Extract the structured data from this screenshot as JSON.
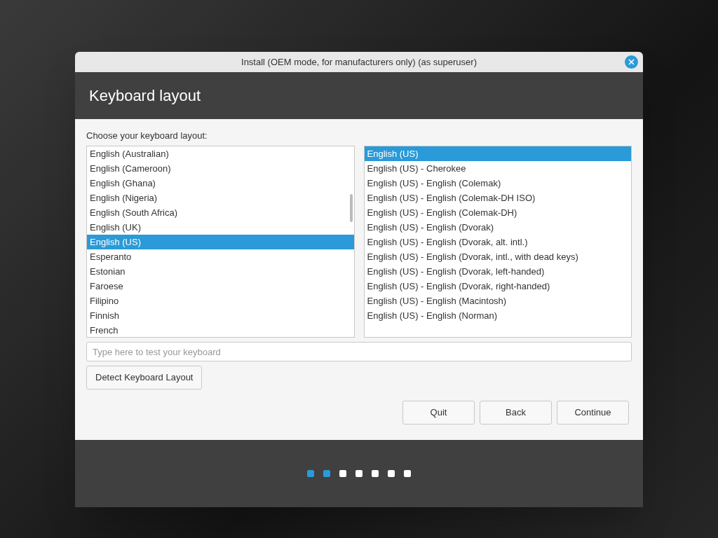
{
  "window": {
    "title": "Install (OEM mode, for manufacturers only) (as superuser)"
  },
  "header": {
    "title": "Keyboard layout"
  },
  "prompt": "Choose your keyboard layout:",
  "layouts": [
    {
      "label": "English (Australian)",
      "selected": false
    },
    {
      "label": "English (Cameroon)",
      "selected": false
    },
    {
      "label": "English (Ghana)",
      "selected": false
    },
    {
      "label": "English (Nigeria)",
      "selected": false
    },
    {
      "label": "English (South Africa)",
      "selected": false
    },
    {
      "label": "English (UK)",
      "selected": false
    },
    {
      "label": "English (US)",
      "selected": true
    },
    {
      "label": "Esperanto",
      "selected": false
    },
    {
      "label": "Estonian",
      "selected": false
    },
    {
      "label": "Faroese",
      "selected": false
    },
    {
      "label": "Filipino",
      "selected": false
    },
    {
      "label": "Finnish",
      "selected": false
    },
    {
      "label": "French",
      "selected": false
    }
  ],
  "variants": [
    {
      "label": "English (US)",
      "selected": true
    },
    {
      "label": "English (US) - Cherokee",
      "selected": false
    },
    {
      "label": "English (US) - English (Colemak)",
      "selected": false
    },
    {
      "label": "English (US) - English (Colemak-DH ISO)",
      "selected": false
    },
    {
      "label": "English (US) - English (Colemak-DH)",
      "selected": false
    },
    {
      "label": "English (US) - English (Dvorak)",
      "selected": false
    },
    {
      "label": "English (US) - English (Dvorak, alt. intl.)",
      "selected": false
    },
    {
      "label": "English (US) - English (Dvorak, intl., with dead keys)",
      "selected": false
    },
    {
      "label": "English (US) - English (Dvorak, left-handed)",
      "selected": false
    },
    {
      "label": "English (US) - English (Dvorak, right-handed)",
      "selected": false
    },
    {
      "label": "English (US) - English (Macintosh)",
      "selected": false
    },
    {
      "label": "English (US) - English (Norman)",
      "selected": false
    }
  ],
  "test_field": {
    "placeholder": "Type here to test your keyboard"
  },
  "detect_button": "Detect Keyboard Layout",
  "buttons": [
    "Quit",
    "Back",
    "Continue"
  ],
  "steps": [
    {
      "done": true
    },
    {
      "done": true
    },
    {
      "done": false
    },
    {
      "done": false
    },
    {
      "done": false
    },
    {
      "done": false
    },
    {
      "done": false
    }
  ]
}
